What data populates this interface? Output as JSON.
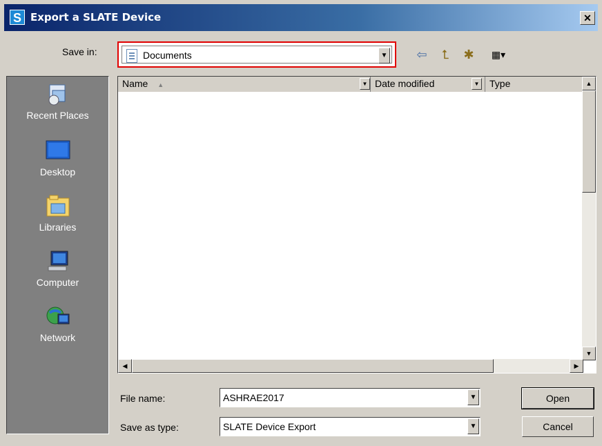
{
  "window": {
    "title": "Export a SLATE Device",
    "app_icon_letter": "S",
    "close_glyph": "✕"
  },
  "save_in": {
    "label": "Save in:",
    "value": "Documents"
  },
  "toolbar": [
    {
      "name": "back-icon",
      "glyph": "⇦"
    },
    {
      "name": "up-folder-icon",
      "glyph": "⮤"
    },
    {
      "name": "new-folder-icon",
      "glyph": "✱"
    },
    {
      "name": "view-menu-icon",
      "glyph": "▦▾"
    }
  ],
  "places": [
    {
      "label": "Recent Places",
      "icon": "recent-places-icon"
    },
    {
      "label": "Desktop",
      "icon": "desktop-icon"
    },
    {
      "label": "Libraries",
      "icon": "libraries-icon"
    },
    {
      "label": "Computer",
      "icon": "computer-icon"
    },
    {
      "label": "Network",
      "icon": "network-icon"
    }
  ],
  "columns": [
    {
      "label": "Name",
      "sort": "▲"
    },
    {
      "label": "Date modified"
    },
    {
      "label": "Type"
    }
  ],
  "file_name": {
    "label": "File name:",
    "value": "ASHRAE2017"
  },
  "save_as_type": {
    "label": "Save as type:",
    "value": "SLATE Device Export"
  },
  "buttons": {
    "open": "Open",
    "cancel": "Cancel"
  },
  "colors": {
    "highlight": "#e00000",
    "title_gradient_start": "#0a246a",
    "places_bg": "#808080"
  }
}
